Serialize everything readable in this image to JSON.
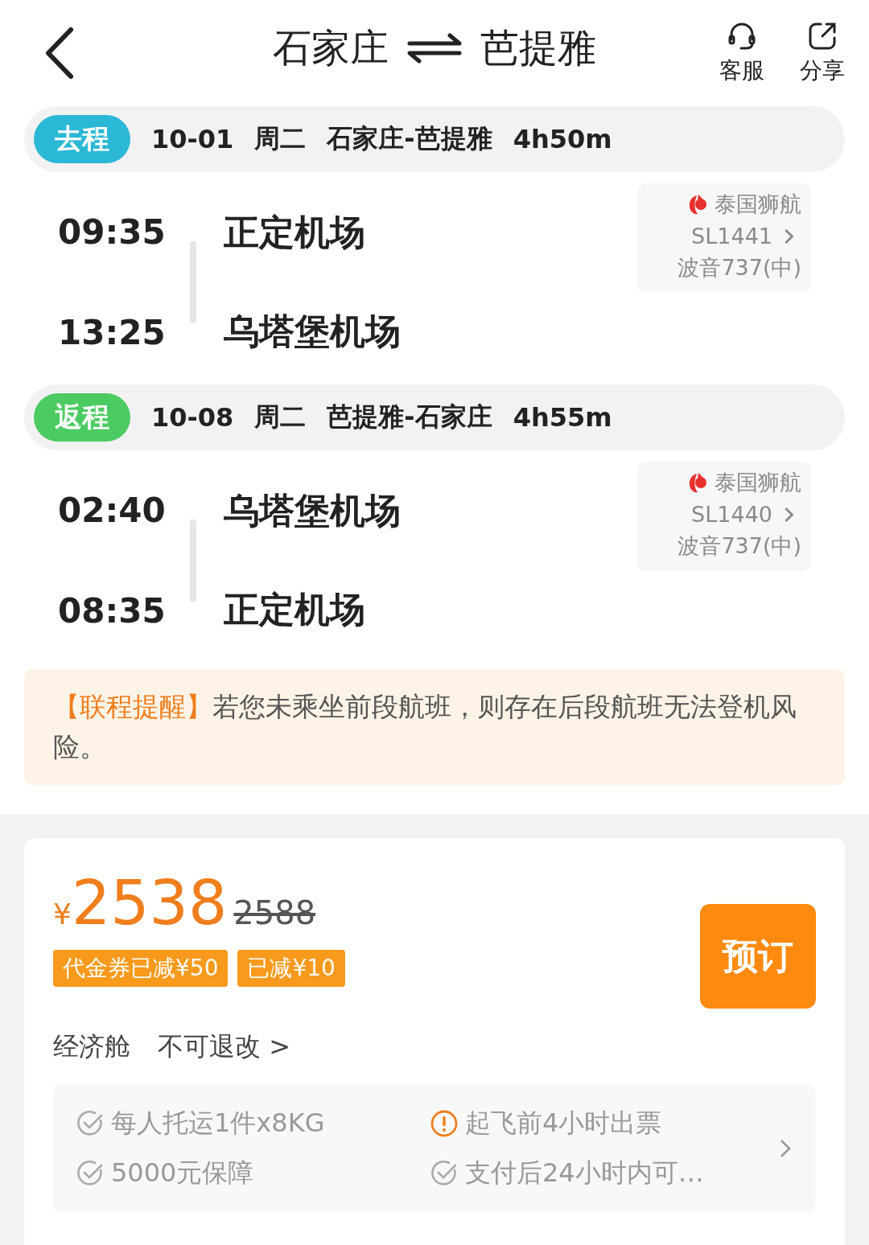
{
  "header": {
    "from": "石家庄",
    "to": "芭提雅",
    "actions": [
      {
        "kind": "service",
        "label": "客服"
      },
      {
        "kind": "share",
        "label": "分享"
      }
    ]
  },
  "legs": [
    {
      "tag": "去程",
      "color": "#2bb8d6",
      "date": "10-01",
      "weekday": "周二",
      "route": "石家庄-芭提雅",
      "duration": "4h50m",
      "dep_time": "09:35",
      "dep_airport": "正定机场",
      "arr_time": "13:25",
      "arr_airport": "乌塔堡机场",
      "airline": "泰国狮航",
      "flight_no": "SL1441",
      "aircraft": "波音737(中)"
    },
    {
      "tag": "返程",
      "color": "#4ccb62",
      "date": "10-08",
      "weekday": "周二",
      "route": "芭提雅-石家庄",
      "duration": "4h55m",
      "dep_time": "02:40",
      "dep_airport": "乌塔堡机场",
      "arr_time": "08:35",
      "arr_airport": "正定机场",
      "airline": "泰国狮航",
      "flight_no": "SL1440",
      "aircraft": "波音737(中)"
    }
  ],
  "notice": {
    "title": "【联程提醒】",
    "text": "若您未乘坐前段航班，则存在后段航班无法登机风险。"
  },
  "offer": {
    "currency": "¥",
    "price": "2538",
    "original_price": "2588",
    "discounts": [
      "代金券已减¥50",
      "已减¥10"
    ],
    "book_button": "预订",
    "cabin": "经济舱",
    "refund": "不可退改 >",
    "features": [
      {
        "kind": "check",
        "text": "每人托运1件x8KG"
      },
      {
        "kind": "warning",
        "text": "起飞前4小时出票"
      },
      {
        "kind": "check",
        "text": "5000元保障"
      },
      {
        "kind": "check",
        "text": "支付后24小时内可…"
      }
    ]
  }
}
